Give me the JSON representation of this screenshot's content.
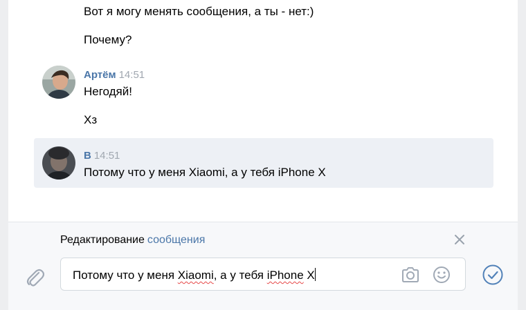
{
  "messages_top": [
    {
      "text": "Вот я могу менять сообщения, а ты - нет:)"
    },
    {
      "text": "Почему?"
    }
  ],
  "artem": {
    "name": "Артём",
    "time": "14:51",
    "messages": [
      "Негодяй!",
      "Хз"
    ]
  },
  "edited_message": {
    "name": "В",
    "time": "14:51",
    "text": "Потому что у меня Xiaomi, а у тебя iPhone X"
  },
  "composer": {
    "edit_label_prefix": "Редактирование",
    "edit_label_link": "сообщения",
    "input_parts": [
      "Потому что у меня ",
      "Xiaomi",
      ", а у тебя ",
      "iPhone",
      " X"
    ]
  },
  "colors": {
    "link": "#4a76a8",
    "highlight": "#edf0f5",
    "icon": "#a0a9b5",
    "send": "#5181b8"
  },
  "icons": {
    "close": "close-icon",
    "attach": "paperclip-icon",
    "camera": "camera-icon",
    "emoji": "smile-icon",
    "send": "checkmark-circle-icon"
  }
}
